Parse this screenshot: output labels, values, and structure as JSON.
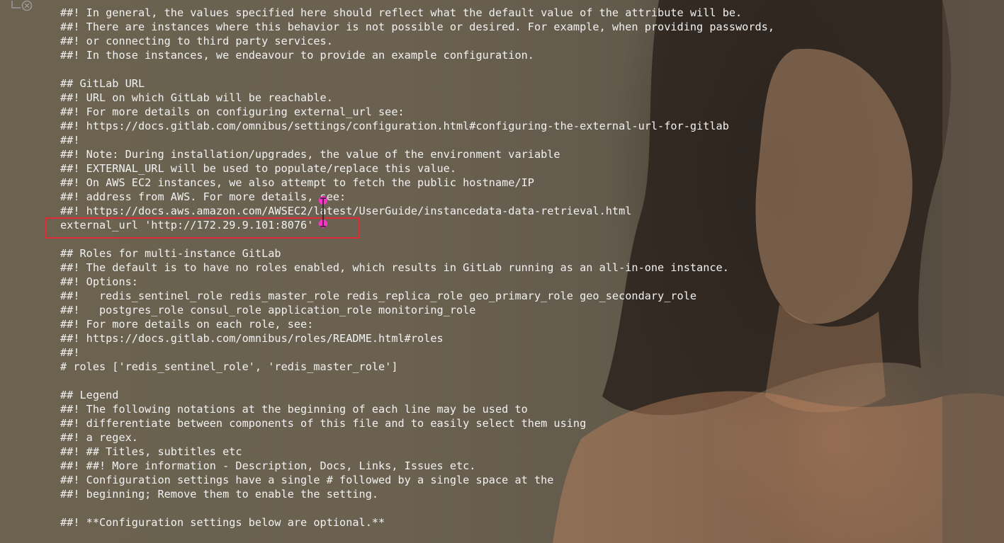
{
  "lines": [
    {
      "text": "##! In general, the values specified here should reflect what the default value of the attribute will be."
    },
    {
      "text": "##! There are instances where this behavior is not possible or desired. For example, when providing passwords,"
    },
    {
      "text": "##! or connecting to third party services."
    },
    {
      "text": "##! In those instances, we endeavour to provide an example configuration."
    },
    {
      "text": ""
    },
    {
      "text": "## GitLab URL"
    },
    {
      "text": "##! URL on which GitLab will be reachable."
    },
    {
      "text": "##! For more details on configuring external_url see:"
    },
    {
      "text": "##! https://docs.gitlab.com/omnibus/settings/configuration.html#configuring-the-external-url-for-gitlab"
    },
    {
      "text": "##!"
    },
    {
      "text": "##! Note: During installation/upgrades, the value of the environment variable"
    },
    {
      "text": "##! EXTERNAL_URL will be used to populate/replace this value."
    },
    {
      "text": "##! On AWS EC2 instances, we also attempt to fetch the public hostname/IP"
    },
    {
      "text": "##! address from AWS. For more details, see:"
    },
    {
      "text": "##! https://docs.aws.amazon.com/AWSEC2/latest/UserGuide/instancedata-data-retrieval.html"
    },
    {
      "text": "external_url 'http://172.29.9.101:8076'"
    },
    {
      "text": ""
    },
    {
      "text": "## Roles for multi-instance GitLab"
    },
    {
      "text": "##! The default is to have no roles enabled, which results in GitLab running as an all-in-one instance."
    },
    {
      "text": "##! Options:"
    },
    {
      "text": "##!   redis_sentinel_role redis_master_role redis_replica_role geo_primary_role geo_secondary_role"
    },
    {
      "text": "##!   postgres_role consul_role application_role monitoring_role"
    },
    {
      "text": "##! For more details on each role, see:"
    },
    {
      "text": "##! https://docs.gitlab.com/omnibus/roles/README.html#roles"
    },
    {
      "text": "##!"
    },
    {
      "text": "# roles ['redis_sentinel_role', 'redis_master_role']"
    },
    {
      "text": ""
    },
    {
      "text": "## Legend"
    },
    {
      "text": "##! The following notations at the beginning of each line may be used to"
    },
    {
      "text": "##! differentiate between components of this file and to easily select them using"
    },
    {
      "text": "##! a regex."
    },
    {
      "text": "##! ## Titles, subtitles etc"
    },
    {
      "text": "##! ##! More information - Description, Docs, Links, Issues etc."
    },
    {
      "text": "##! Configuration settings have a single # followed by a single space at the"
    },
    {
      "text": "##! beginning; Remove them to enable the setting."
    },
    {
      "text": ""
    },
    {
      "text": "##! **Configuration settings below are optional.**"
    }
  ],
  "highlight_color": "#e02a36",
  "cursor_color": "#ff33cc",
  "text_color": "#f2f2f2",
  "icons": {
    "gutter": "line-settings-icon",
    "cursor": "ibeam-cursor-icon"
  }
}
